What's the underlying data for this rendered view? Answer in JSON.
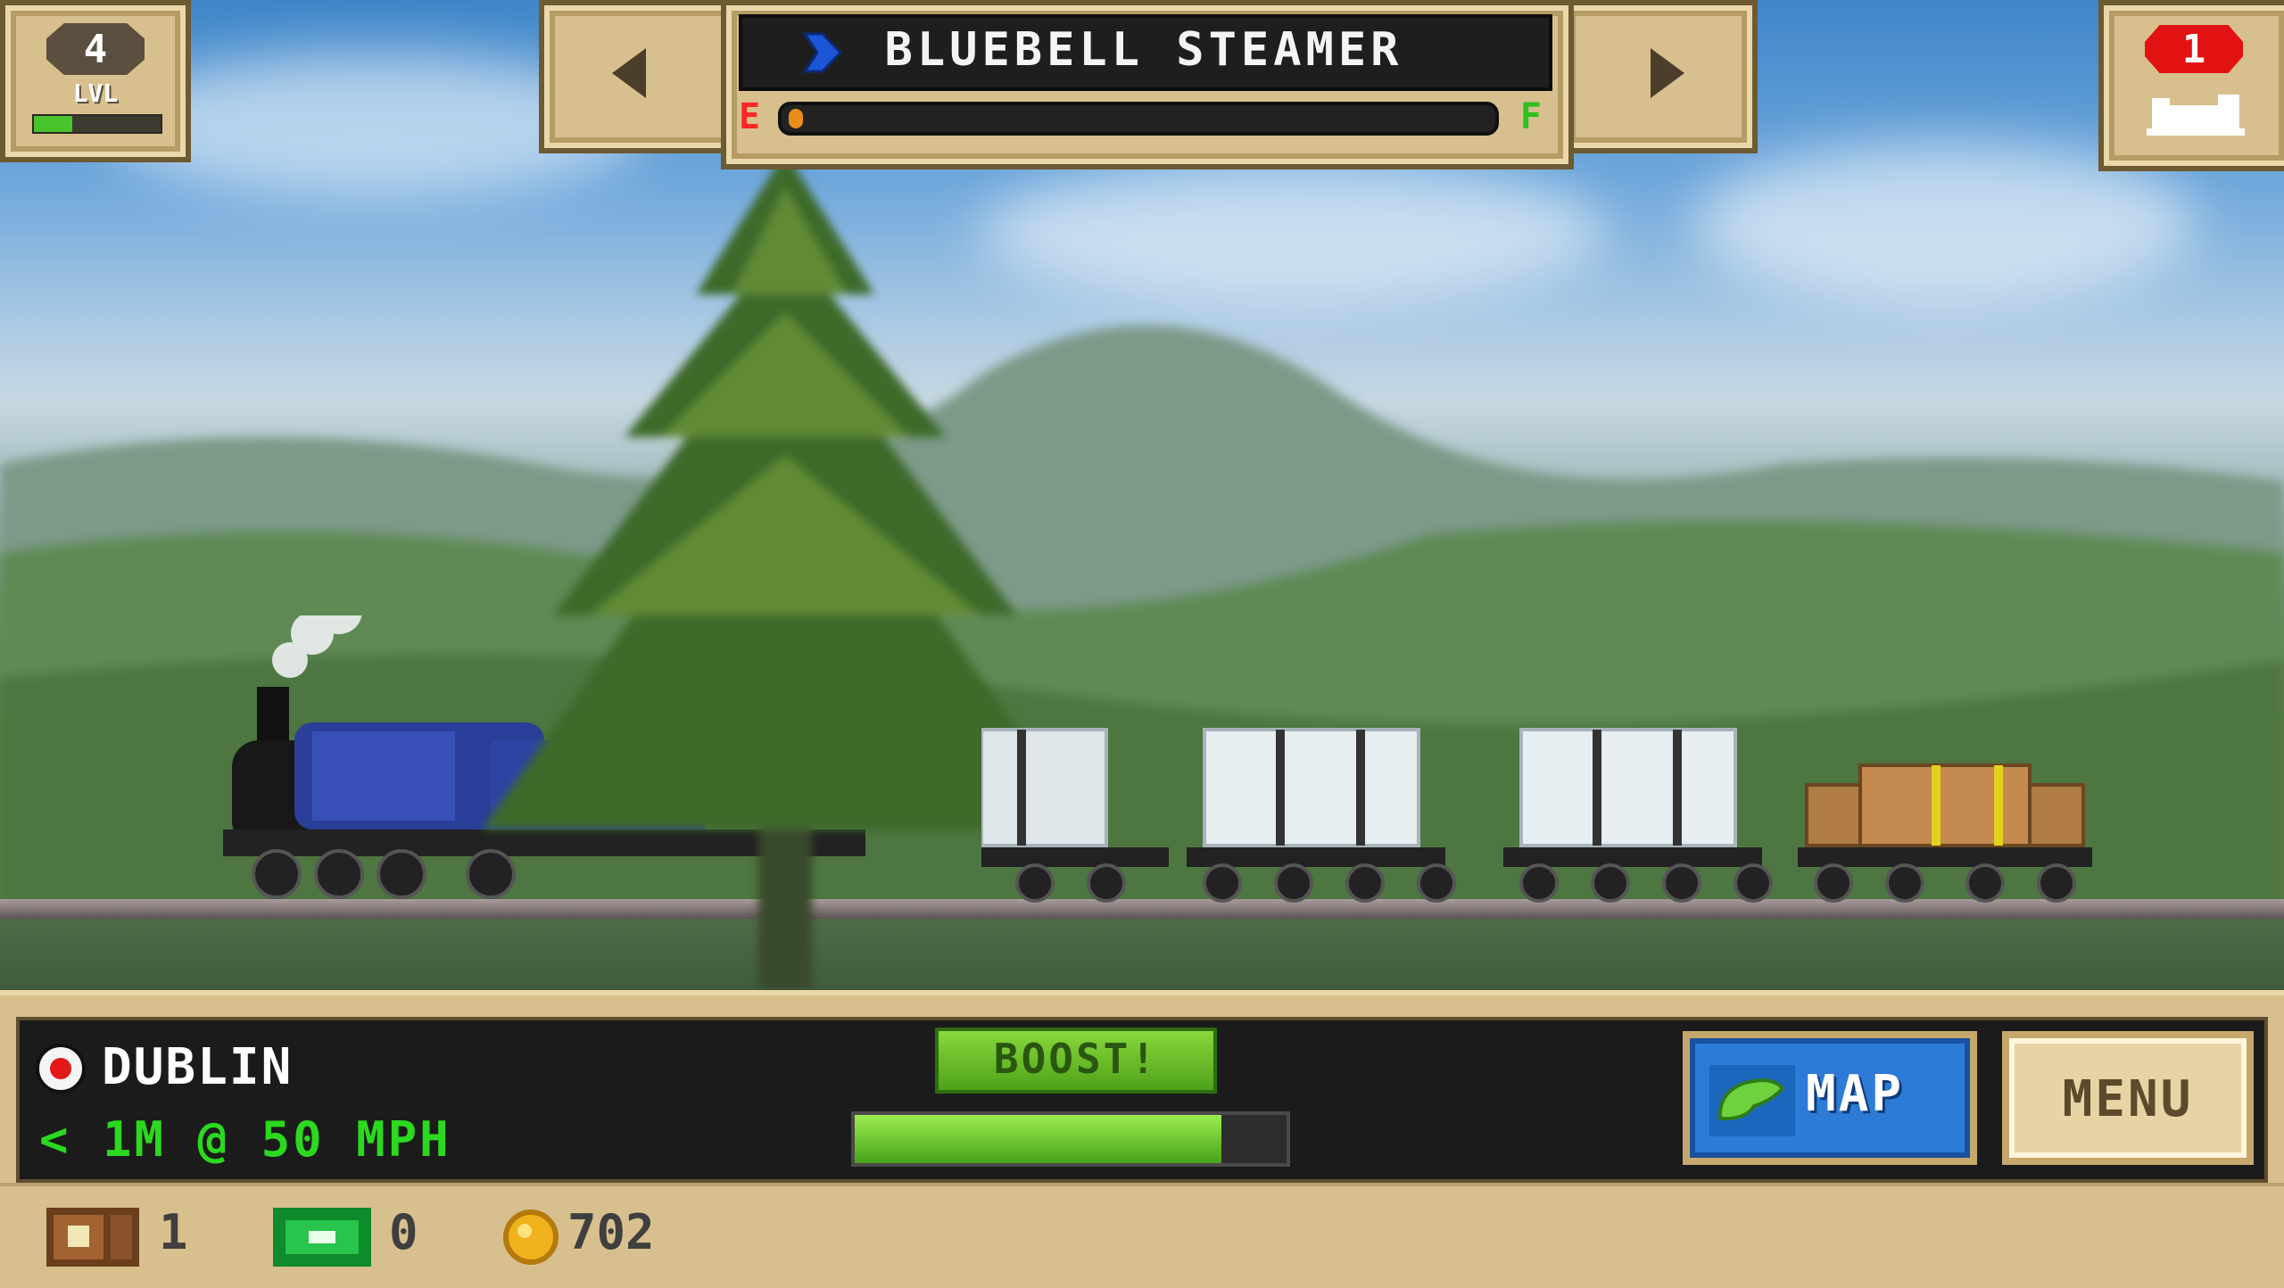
{
  "hud": {
    "level": {
      "number": "4",
      "label": "LVL",
      "progress": 0.3
    },
    "train": {
      "name": "BLUEBELL STEAMER",
      "fuel_empty_label": "E",
      "fuel_full_label": "F",
      "fuel_level": 0.0
    },
    "alerts": {
      "count": "1"
    }
  },
  "bottom": {
    "station": "DUBLIN",
    "distance": "< 1M @ 50 MPH",
    "boost_label": "BOOST!",
    "boost_level": 0.85,
    "map_label": "MAP",
    "menu_label": "MENU"
  },
  "status": {
    "crates": "1",
    "cash": "0",
    "coins": "702"
  },
  "colors": {
    "accent_green": "#2bd91e",
    "alert_red": "#e31212",
    "panel_tan": "#d7c08e",
    "map_blue": "#2c7bd7"
  },
  "icons": [
    "left-arrow-icon",
    "right-arrow-icon",
    "train-type-icon",
    "train-icon",
    "station-icon",
    "map-icon",
    "crate-icon",
    "cash-icon",
    "coin-icon"
  ]
}
